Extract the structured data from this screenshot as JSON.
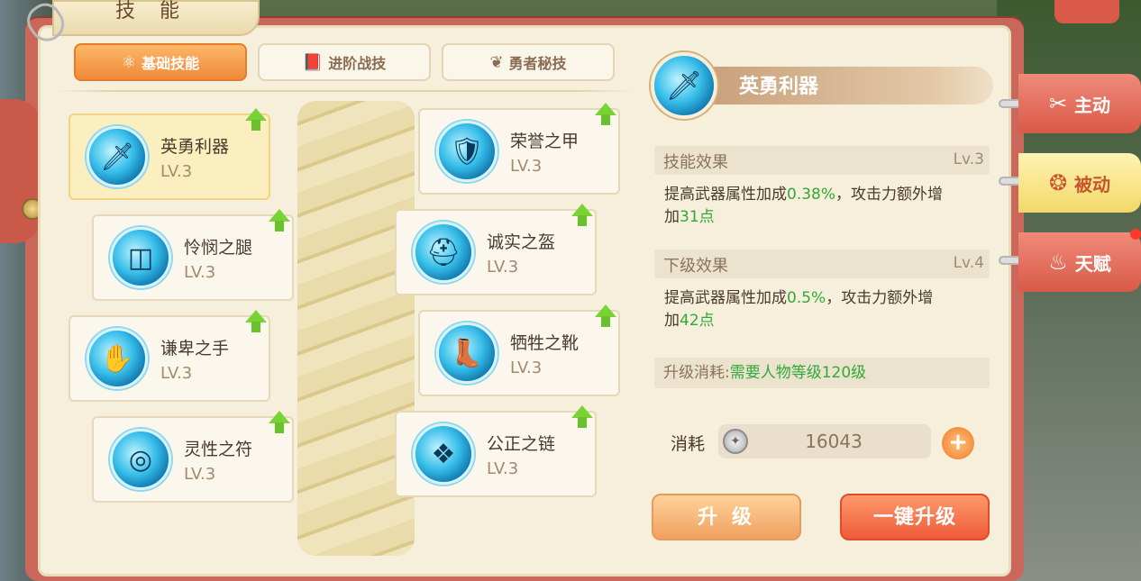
{
  "window": {
    "title": "技 能"
  },
  "top_tabs": [
    {
      "label": "基础技能",
      "icon": "atom-icon",
      "active": true
    },
    {
      "label": "进阶战技",
      "icon": "book-icon",
      "active": false
    },
    {
      "label": "勇者秘技",
      "icon": "wing-icon",
      "active": false
    }
  ],
  "skills": [
    {
      "name": "英勇利器",
      "level": "LV.3",
      "icon": "sword-icon",
      "selected": true
    },
    {
      "name": "荣誉之甲",
      "level": "LV.3",
      "icon": "armor-icon"
    },
    {
      "name": "怜悯之腿",
      "level": "LV.3",
      "icon": "belt-icon"
    },
    {
      "name": "诚实之盔",
      "level": "LV.3",
      "icon": "helmet-icon"
    },
    {
      "name": "谦卑之手",
      "level": "LV.3",
      "icon": "glove-icon"
    },
    {
      "name": "牺牲之靴",
      "level": "LV.3",
      "icon": "boots-icon"
    },
    {
      "name": "灵性之符",
      "level": "LV.3",
      "icon": "amulet-icon"
    },
    {
      "name": "公正之链",
      "level": "LV.3",
      "icon": "necklace-icon"
    }
  ],
  "detail": {
    "title": "英勇利器",
    "effect_label": "技能效果",
    "effect_level": "Lv.3",
    "effect_text_a": "提高武器属性加成",
    "effect_pct": "0.38%",
    "effect_text_b": "，攻击力额外增",
    "effect_text_c": "加",
    "effect_points": "31点",
    "next_label": "下级效果",
    "next_level": "Lv.4",
    "next_text_a": "提高武器属性加成",
    "next_pct": "0.5%",
    "next_text_b": "，攻击力额外增",
    "next_text_c": "加",
    "next_points": "42点",
    "req_label": "升级消耗:",
    "req_value": "需要人物等级120级",
    "cost_label": "消耗",
    "cost_value": "16043",
    "plus": "+",
    "btn_upgrade": "升 级",
    "btn_onekey": "一键升级"
  },
  "side_tabs": [
    {
      "label": "主动",
      "icon": "slash-icon"
    },
    {
      "label": "被动",
      "icon": "swirl-icon"
    },
    {
      "label": "天赋",
      "icon": "flame-icon"
    }
  ],
  "colors": {
    "accent": "#f08a3a",
    "green": "#33a83a",
    "red_tab": "#d95a48",
    "yellow_tab": "#f2d86a"
  }
}
